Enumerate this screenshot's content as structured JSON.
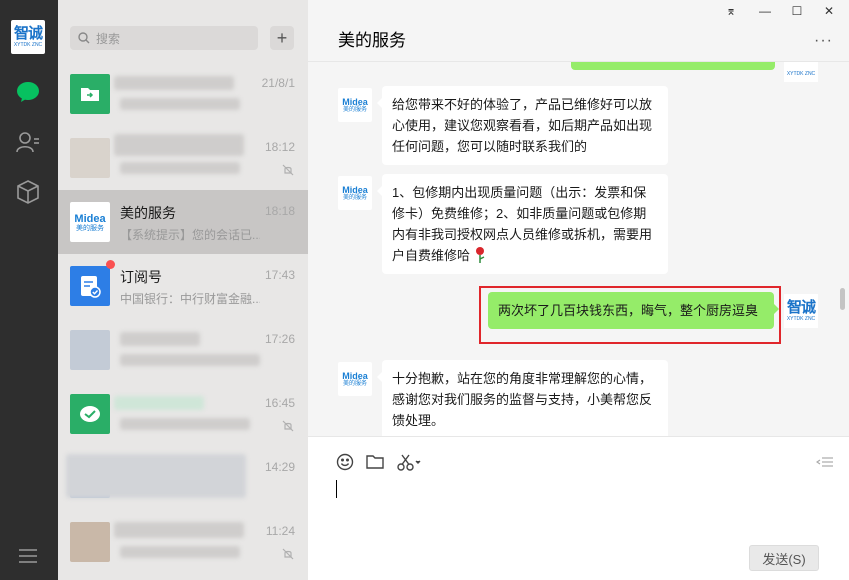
{
  "rail": {
    "avatar_zh": "智诚",
    "avatar_en": "XYTDK ZNC",
    "icons": [
      "chat-icon",
      "contacts-icon",
      "box-icon",
      "menu-icon"
    ],
    "accent": "#07c160"
  },
  "search": {
    "placeholder": "搜索",
    "plus": "+"
  },
  "chats": [
    {
      "name": "",
      "preview": "",
      "time": "21/8/1",
      "avatar": "folder-icon"
    },
    {
      "name": "",
      "preview": "",
      "time": "18:12",
      "muted": true
    },
    {
      "name": "美的服务",
      "preview": "【系统提示】您的会话已...",
      "time": "18:18",
      "active": true,
      "avatar_text": "Midea",
      "avatar_sub": "美的服务"
    },
    {
      "name": "订阅号",
      "preview": "中国银行：中行财富金融...",
      "time": "17:43",
      "badge": true
    },
    {
      "name": "",
      "preview": "",
      "time": "17:26"
    },
    {
      "name": "",
      "preview": "",
      "time": "16:45",
      "muted": true
    },
    {
      "name": "",
      "preview": "",
      "time": "14:29"
    },
    {
      "name": "",
      "preview": "",
      "time": "11:24",
      "muted": true
    }
  ],
  "header": {
    "title": "美的服务",
    "pin": "⌆",
    "minimize": "—",
    "maximize": "☐",
    "close": "✕",
    "more": "···"
  },
  "messages": [
    {
      "from": "service",
      "text": "给您带来不好的体验了，产品已维修好可以放心使用，建议您观察看看，如后期产品如出现任何问题，您可以随时联系我们的"
    },
    {
      "from": "service",
      "text": "1、包修期内出现质量问题（出示：发票和保修卡）免费维修；2、如非质量问题或包修期内有非我司授权网点人员维修或拆机，需要用户自费维修哈"
    },
    {
      "from": "me",
      "text": "两次坏了几百块钱东西，晦气，整个厨房逗臭"
    },
    {
      "from": "service",
      "text": "十分抱歉，站在您的角度非常理解您的心情，感谢您对我们服务的监督与支持，小美帮您反馈处理。"
    }
  ],
  "service_avatar": {
    "logo": "Midea",
    "sub": "美的服务"
  },
  "me_avatar": {
    "zh": "智诚",
    "en": "XYTDK ZNC"
  },
  "input": {
    "send_label": "发送(S)"
  }
}
